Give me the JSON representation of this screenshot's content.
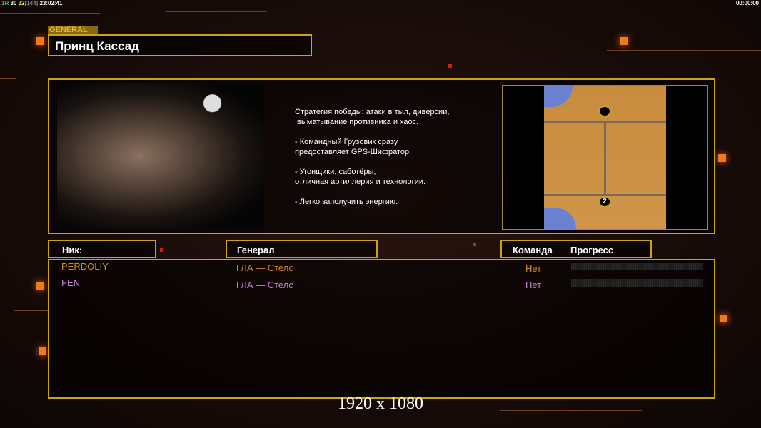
{
  "status": {
    "a": "1R",
    "b": "30",
    "c": "32",
    "d": "[144]",
    "time": "23:02:41",
    "timer": "00:00:00"
  },
  "general": {
    "tab": "GENERAL",
    "name": "Принц Кассад"
  },
  "description": [
    "Стратегия победы: атаки в тыл, диверсии,",
    " выматывание противника и хаос.",
    "",
    "- Командный Грузовик сразу",
    "предоставляет GPS-Шифратор.",
    "",
    "- Угонщики, саботёры,",
    "отличная артиллерия и технологии.",
    "",
    "- Легко заполучить энергию."
  ],
  "headers": {
    "nick": "Ник:",
    "general": "Генерал",
    "team": "Команда",
    "progress": "Прогресс"
  },
  "players": [
    {
      "nick": "PERDOLIY",
      "general": "ГЛА — Стелс",
      "team": "Нет",
      "color": "#d98a1c",
      "progress": 0
    },
    {
      "nick": "FEN",
      "general": "ГЛА — Стелс",
      "team": "Нет",
      "color": "#c883d8",
      "progress": 0
    }
  ],
  "map": {
    "start_marker": "2"
  },
  "watermark": "1920 x 1080"
}
